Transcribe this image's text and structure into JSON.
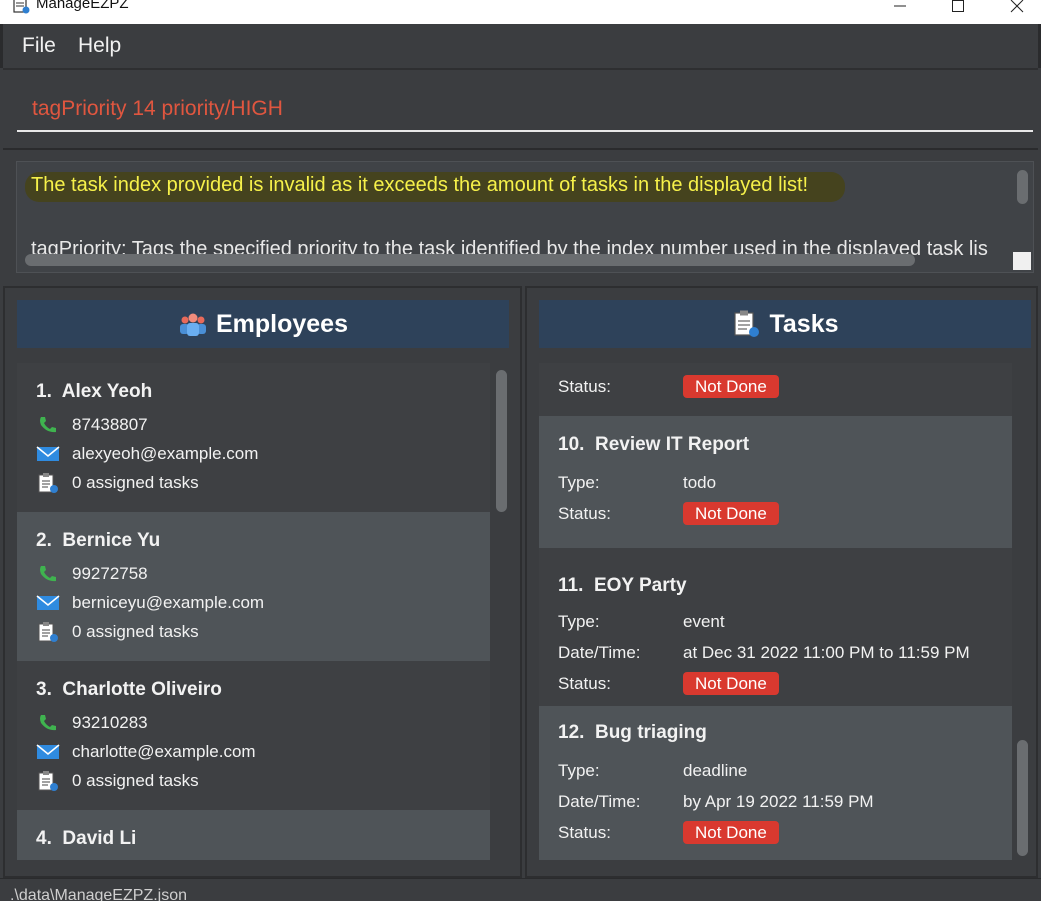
{
  "window": {
    "title": "ManageEZPZ"
  },
  "menu": {
    "file": "File",
    "help": "Help"
  },
  "command": {
    "value": "tagPriority 14 priority/HIGH"
  },
  "result": {
    "line1": "The task index provided is invalid as it exceeds the amount of tasks in the displayed list!",
    "line2": "tagPriority: Tags the specified priority to the task identified by the index number used in the displayed task lis"
  },
  "employees": {
    "header": "Employees",
    "items": [
      {
        "index": "1.",
        "name": "Alex Yeoh",
        "phone": "87438807",
        "email": "alexyeoh@example.com",
        "tasks": "0 assigned tasks"
      },
      {
        "index": "2.",
        "name": "Bernice Yu",
        "phone": "99272758",
        "email": "berniceyu@example.com",
        "tasks": "0 assigned tasks"
      },
      {
        "index": "3.",
        "name": "Charlotte Oliveiro",
        "phone": "93210283",
        "email": "charlotte@example.com",
        "tasks": "0 assigned tasks"
      },
      {
        "index": "4.",
        "name": "David Li"
      }
    ]
  },
  "tasks": {
    "header": "Tasks",
    "labels": {
      "type": "Type:",
      "datetime": "Date/Time:",
      "status": "Status:"
    },
    "partial_status": "Not Done",
    "items": [
      {
        "index": "10.",
        "name": "Review IT Report",
        "type": "todo",
        "status": "Not Done"
      },
      {
        "index": "11.",
        "name": "EOY Party",
        "type": "event",
        "datetime": "at Dec 31 2022 11:00 PM to 11:59 PM",
        "status": "Not Done"
      },
      {
        "index": "12.",
        "name": "Bug triaging",
        "type": "deadline",
        "datetime": "by Apr 19 2022 11:59 PM",
        "status": "Not Done"
      }
    ]
  },
  "statusbar": {
    "path": ".\\data\\ManageEZPZ.json"
  },
  "colors": {
    "accent": "#2e425a",
    "badge": "#d9392f",
    "result_text": "#f6f14a",
    "command_text": "#e0563f"
  }
}
